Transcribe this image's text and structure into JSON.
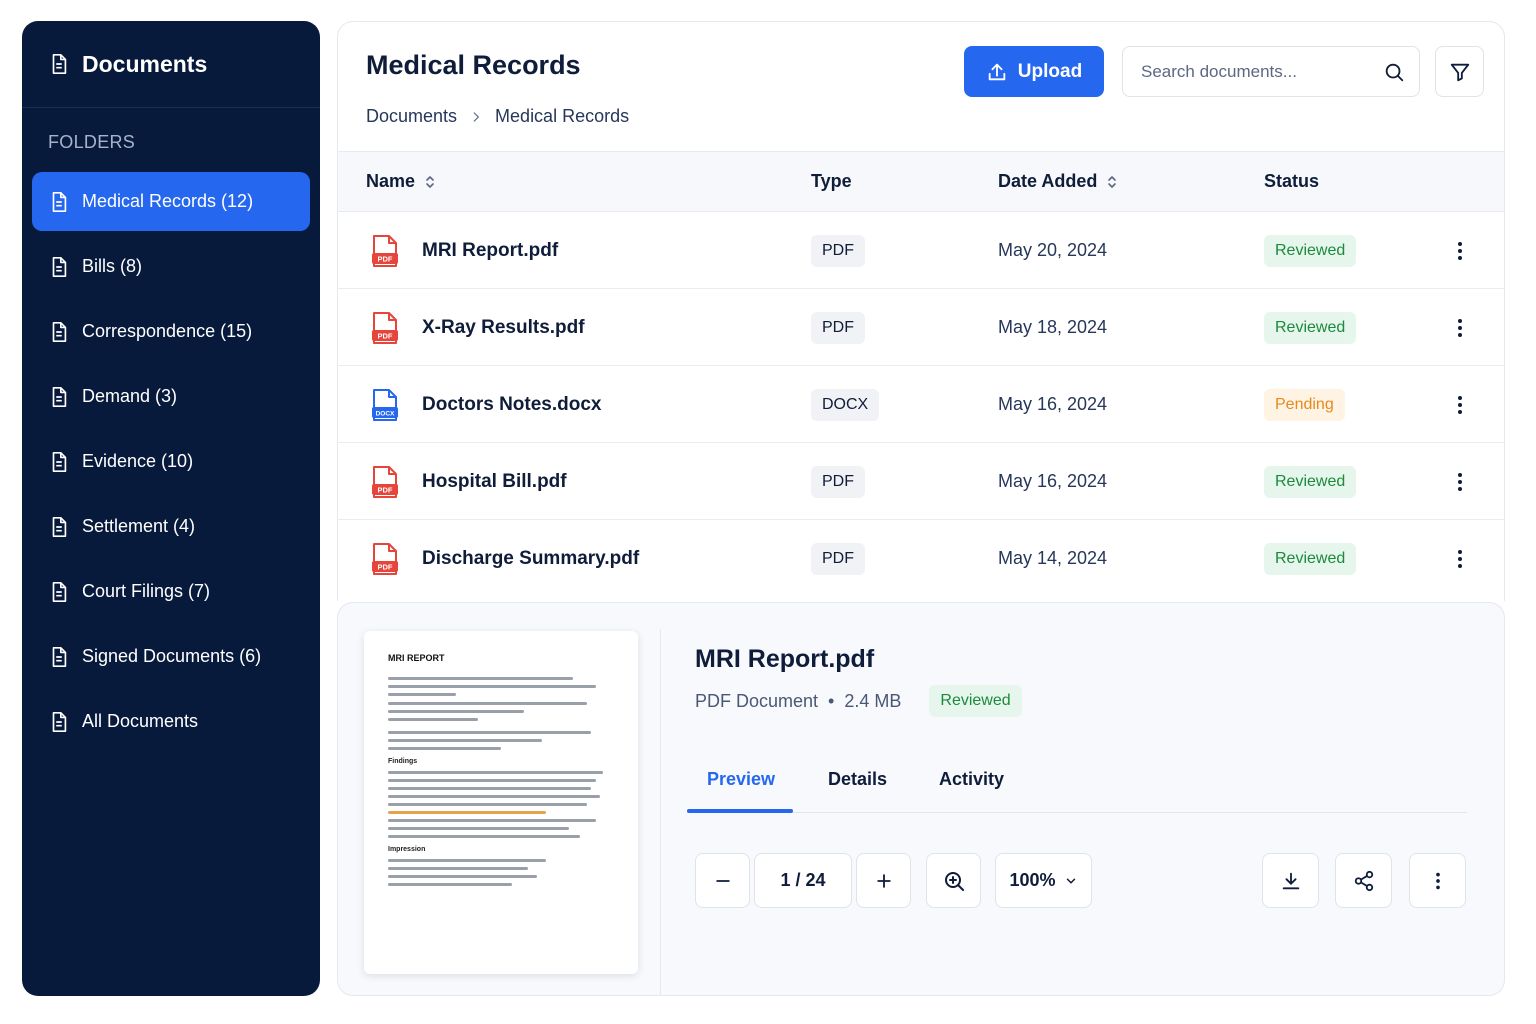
{
  "sidebar": {
    "title": "Documents",
    "section_label": "FOLDERS",
    "items": [
      {
        "label": "Medical Records (12)"
      },
      {
        "label": "Bills (8)"
      },
      {
        "label": "Correspondence (15)"
      },
      {
        "label": "Demand (3)"
      },
      {
        "label": "Evidence (10)"
      },
      {
        "label": "Settlement (4)"
      },
      {
        "label": "Court Filings (7)"
      },
      {
        "label": "Signed Documents (6)"
      },
      {
        "label": "All Documents"
      }
    ]
  },
  "header": {
    "title": "Medical Records",
    "breadcrumb": [
      "Documents",
      "Medical Records"
    ],
    "upload_label": "Upload",
    "search_placeholder": "Search documents..."
  },
  "table": {
    "columns": [
      "Name",
      "Type",
      "Date Added",
      "Status"
    ],
    "rows": [
      {
        "name": "MRI Report.pdf",
        "icon": "pdf-file-icon",
        "icon_label": "PDF",
        "type": "PDF",
        "date": "May 20, 2024",
        "status": "Reviewed"
      },
      {
        "name": "X-Ray Results.pdf",
        "icon": "pdf-file-icon",
        "icon_label": "PDF",
        "type": "PDF",
        "date": "May 18, 2024",
        "status": "Reviewed"
      },
      {
        "name": "Doctors Notes.docx",
        "icon": "docx-file-icon",
        "icon_label": "DOCX",
        "type": "DOCX",
        "date": "May 16, 2024",
        "status": "Pending"
      },
      {
        "name": "Hospital Bill.pdf",
        "icon": "pdf-file-icon",
        "icon_label": "PDF",
        "type": "PDF",
        "date": "May 16, 2024",
        "status": "Reviewed"
      },
      {
        "name": "Discharge Summary.pdf",
        "icon": "pdf-file-icon",
        "icon_label": "PDF",
        "type": "PDF",
        "date": "May 14, 2024",
        "status": "Reviewed"
      }
    ]
  },
  "preview": {
    "thumbnail_title": "MRI REPORT",
    "thumbnail_headings": [
      "Findings",
      "Impression"
    ],
    "title": "MRI Report.pdf",
    "doc_type": "PDF Document",
    "separator": "•",
    "size": "2.4 MB",
    "status": "Reviewed",
    "tabs": [
      "Preview",
      "Details",
      "Activity"
    ],
    "page_indicator": "1 / 24",
    "zoom": "100%"
  },
  "colors": {
    "sidebar_bg": "#081a3c",
    "accent": "#2667f0",
    "reviewed_text": "#1b8a3c",
    "reviewed_bg": "#e7f6ec",
    "pending_text": "#e68a1f",
    "pending_bg": "#fff3e3",
    "pdf_red": "#e5453a",
    "docx_blue": "#2667f0"
  }
}
